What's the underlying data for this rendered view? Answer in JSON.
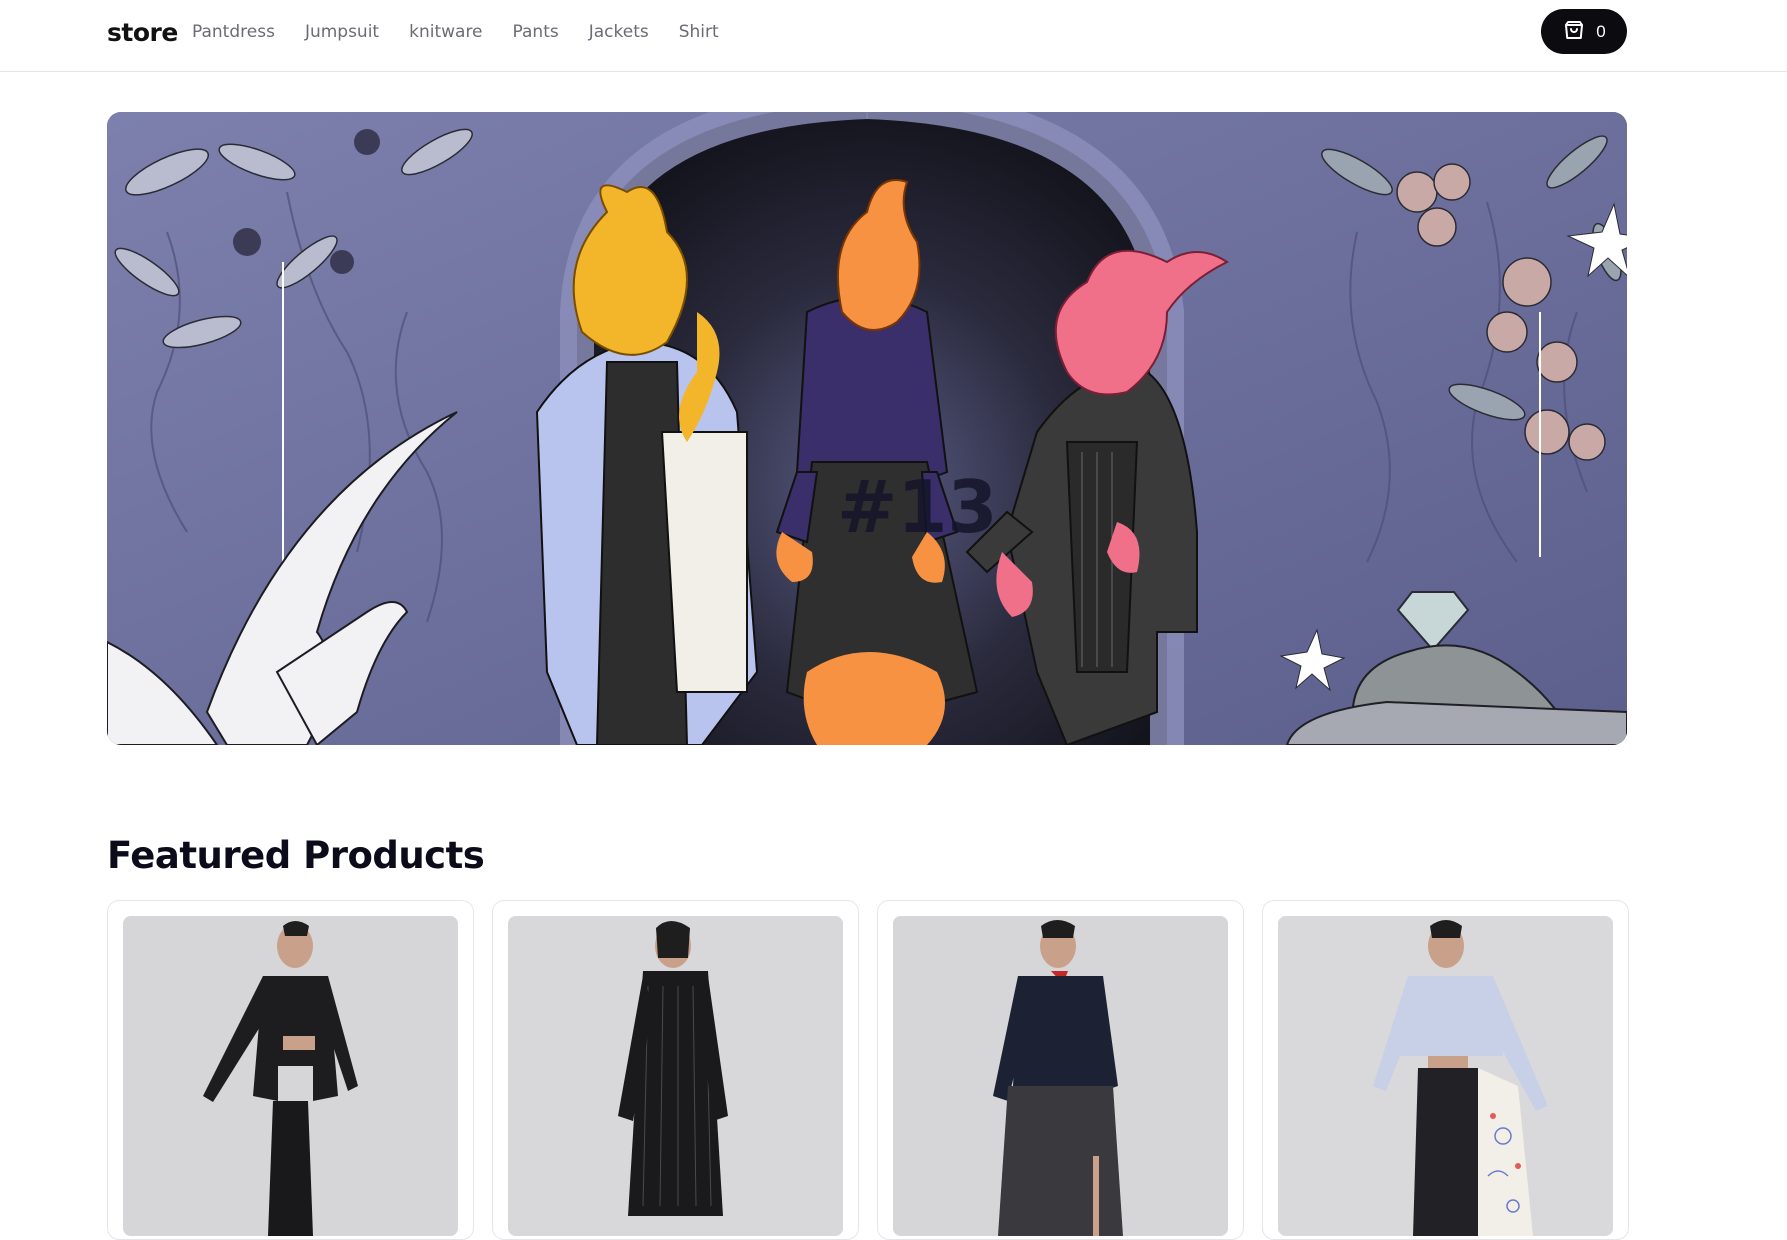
{
  "header": {
    "brand": "store",
    "nav": [
      "Pantdress",
      "Jumpsuit",
      "knitware",
      "Pants",
      "Jackets",
      "Shirt"
    ],
    "cart_icon": "shopping-bag-icon",
    "cart_count": "0"
  },
  "hero": {
    "overlay_text": "#13",
    "colors": {
      "wall": "#6c6f9c",
      "arch_dark": "#15151f",
      "flame_yellow": "#f3b52a",
      "flame_orange": "#f79243",
      "flame_pink": "#f0708a"
    }
  },
  "featured": {
    "title": "Featured Products",
    "products": [
      {
        "image": "model in black cropped blazer and trousers"
      },
      {
        "image": "model in black striped sheer long shirt"
      },
      {
        "image": "model in dark sequin jacket and long skirt"
      },
      {
        "image": "model in light blue cropped jacket and printed skirt"
      }
    ]
  }
}
